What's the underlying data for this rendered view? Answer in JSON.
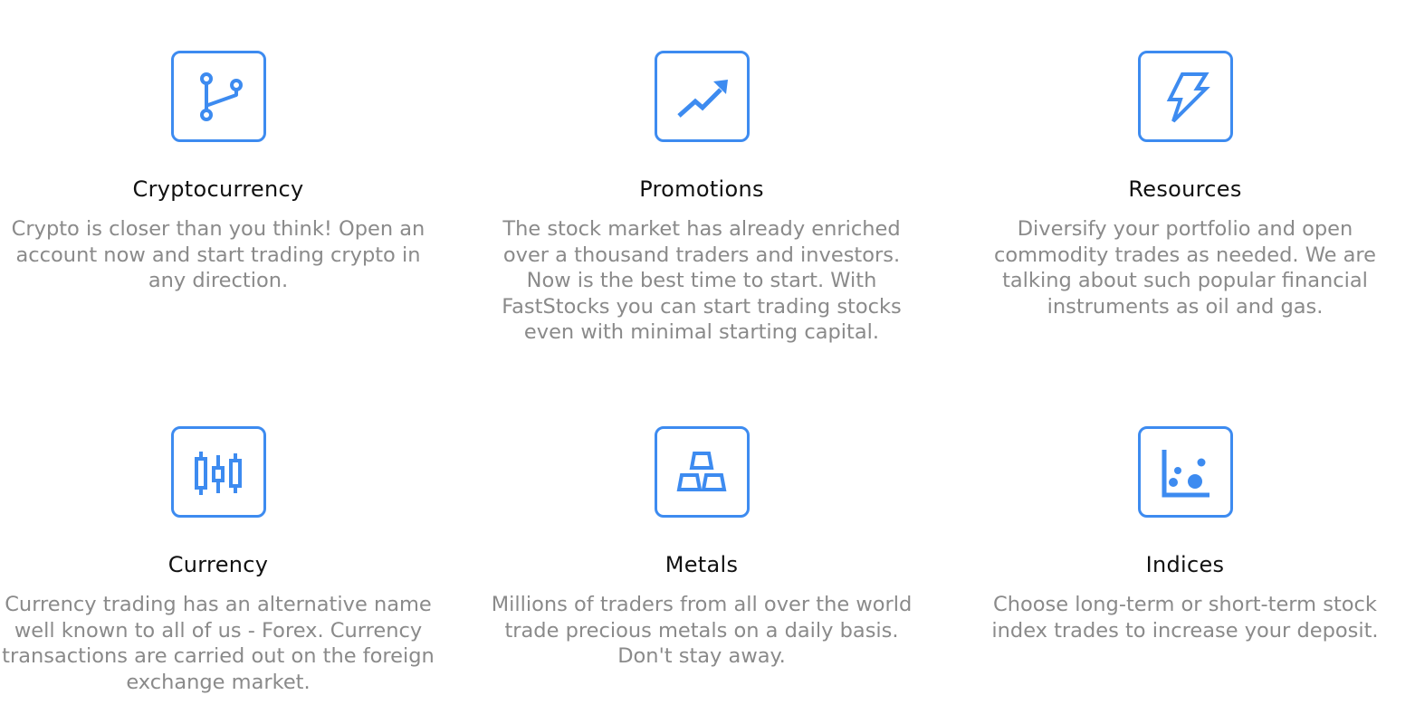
{
  "accent_color": "#3d8bf0",
  "features": [
    {
      "icon": "git-branch-icon",
      "title": "Cryptocurrency",
      "description": "Crypto is closer than you think! Open an account now and start trading crypto in any direction."
    },
    {
      "icon": "trending-up-icon",
      "title": "Promotions",
      "description": "The stock market has already enriched over a thousand traders and investors. Now is the best time to start. With FastStocks you can start trading stocks even with minimal starting capital."
    },
    {
      "icon": "lightning-icon",
      "title": "Resources",
      "description": "Diversify your portfolio and open commodity trades as needed. We are talking about such popular financial instruments as oil and gas."
    },
    {
      "icon": "candlestick-icon",
      "title": "Currency",
      "description": "Currency trading has an alternative name well known to all of us - Forex. Currency transactions are carried out on the foreign exchange market."
    },
    {
      "icon": "gold-bars-icon",
      "title": "Metals",
      "description": "Millions of traders from all over the world trade precious metals on a daily basis. Don't stay away."
    },
    {
      "icon": "scatter-chart-icon",
      "title": "Indices",
      "description": "Choose long-term or short-term stock index trades to increase your deposit."
    }
  ]
}
